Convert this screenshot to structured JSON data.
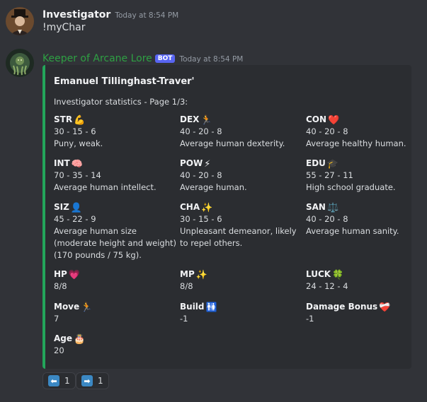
{
  "messages": [
    {
      "username": "Investigator",
      "timestamp": "Today at 8:54 PM",
      "content": "!myChar"
    },
    {
      "username": "Keeper of Arcane Lore",
      "bot_tag": "BOT",
      "timestamp": "Today at 8:54 PM",
      "embed": {
        "title": "Emanuel Tillinghast-Traver'",
        "description": "Investigator statistics - Page 1/3:",
        "accent_color": "#23a55a",
        "fields": [
          {
            "name": "STR",
            "emoji": "💪",
            "value": "30 - 15 - 6",
            "desc": [
              "Puny, weak."
            ]
          },
          {
            "name": "DEX",
            "emoji": "🏃",
            "value": "40 - 20 - 8",
            "desc": [
              "Average human dexterity."
            ]
          },
          {
            "name": "CON",
            "emoji": "❤️",
            "value": "40 - 20 - 8",
            "desc": [
              "Average healthy human."
            ]
          },
          {
            "name": "INT",
            "emoji": "🧠",
            "value": "70 - 35 - 14",
            "desc": [
              "Average human intellect."
            ]
          },
          {
            "name": "POW",
            "emoji": "⚡",
            "value": "40 - 20 - 8",
            "desc": [
              "Average human."
            ]
          },
          {
            "name": "EDU",
            "emoji": "🎓",
            "value": "55 - 27 - 11",
            "desc": [
              "High school graduate."
            ]
          },
          {
            "name": "SIZ",
            "emoji": "👤",
            "value": "45 - 22 - 9",
            "desc": [
              "Average human size",
              "(moderate height and weight)",
              "(170 pounds / 75 kg)."
            ]
          },
          {
            "name": "CHA",
            "emoji": "✨",
            "value": "30 - 15 - 6",
            "desc": [
              "Unpleasant demeanor, likely",
              "to repel others."
            ]
          },
          {
            "name": "SAN",
            "emoji": "⚖️",
            "value": "40 - 20 - 8",
            "desc": [
              "Average human sanity."
            ]
          },
          {
            "name": "HP",
            "emoji": "💗",
            "value": "8/8",
            "desc": []
          },
          {
            "name": "MP",
            "emoji": "✨",
            "value": "8/8",
            "desc": []
          },
          {
            "name": "LUCK",
            "emoji": "🍀",
            "value": "24 - 12 - 4",
            "desc": []
          },
          {
            "name": "Move",
            "emoji": "🏃",
            "value": "7",
            "desc": []
          },
          {
            "name": "Build",
            "emoji": "🚻",
            "value": "-1",
            "desc": []
          },
          {
            "name": "Damage Bonus",
            "emoji": "❤️‍🩹",
            "value": "-1",
            "desc": []
          },
          {
            "name": "Age",
            "emoji": "🎂",
            "value": "20",
            "desc": []
          }
        ]
      },
      "reactions": [
        {
          "icon": "left-arrow-icon",
          "glyph": "⬅",
          "count": "1"
        },
        {
          "icon": "right-arrow-icon",
          "glyph": "➡",
          "count": "1"
        }
      ]
    }
  ]
}
